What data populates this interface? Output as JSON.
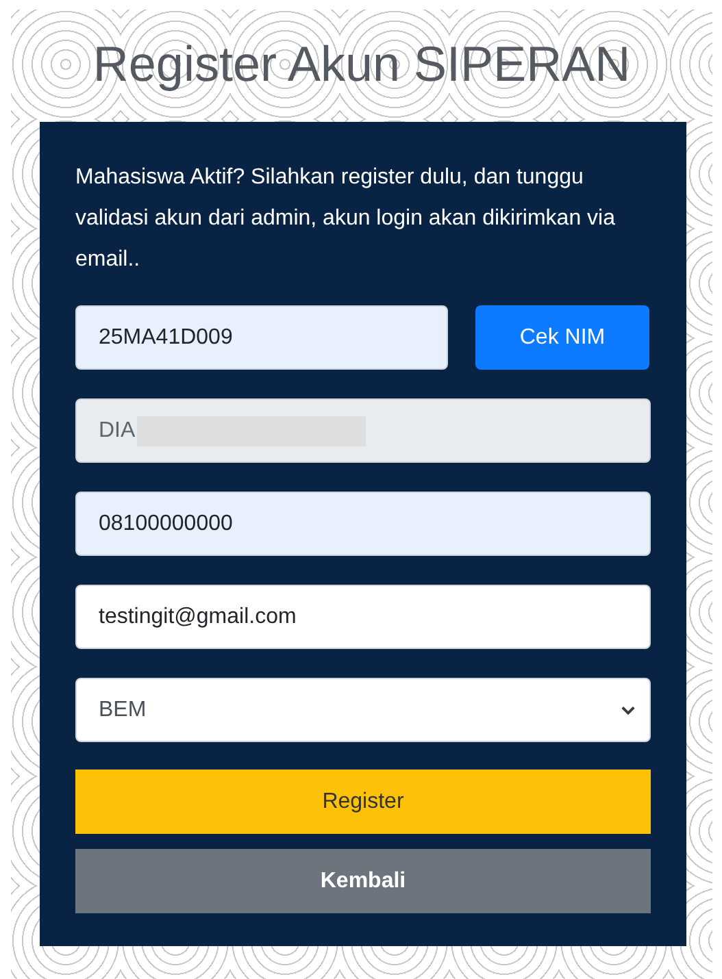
{
  "title": "Register Akun SIPERAN",
  "intro": "Mahasiswa Aktif? Silahkan register dulu, dan tunggu validasi akun dari admin, akun login akan dikirimkan via email..",
  "nim_field": {
    "value": "25MA41D009",
    "autofilled": true
  },
  "check_button": "Cek NIM",
  "fields": [
    {
      "kind": "text",
      "value": "DIA",
      "disabled": true,
      "autofilled": false,
      "redacted": true
    },
    {
      "kind": "text",
      "value": "08100000000",
      "disabled": false,
      "autofilled": true,
      "redacted": false
    },
    {
      "kind": "text",
      "value": "testingit@gmail.com",
      "disabled": false,
      "autofilled": false,
      "redacted": false
    },
    {
      "kind": "select",
      "value": "BEM",
      "disabled": false,
      "autofilled": false,
      "redacted": false
    }
  ],
  "buttons": [
    {
      "kind": "primary",
      "label": "Register"
    },
    {
      "kind": "secondary",
      "label": "Kembali"
    }
  ]
}
